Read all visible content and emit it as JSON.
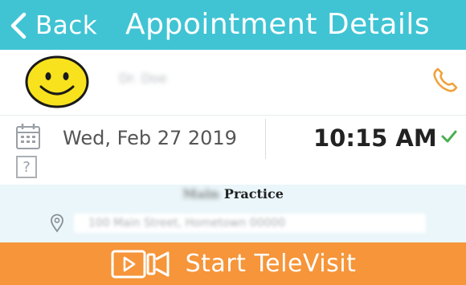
{
  "header": {
    "back_label": "Back",
    "title": "Appointment Details",
    "color": "#40c4d4"
  },
  "doctor": {
    "name": "Dr. Doe",
    "avatar_icon": "smiley-face-icon",
    "call_icon": "phone-icon"
  },
  "appointment": {
    "date": "Wed, Feb 27  2019",
    "time": "10:15 AM",
    "calendar_icon": "calendar-icon",
    "help_glyph": "?",
    "confirmed_icon": "check-icon"
  },
  "practice": {
    "name_blurred": "Main",
    "label": "Practice",
    "address": "100 Main Street, Hometown 00000",
    "location_icon": "location-pin-icon"
  },
  "cta": {
    "label": "Start TeleVisit",
    "icon": "video-camera-icon",
    "color": "#f6953a"
  }
}
